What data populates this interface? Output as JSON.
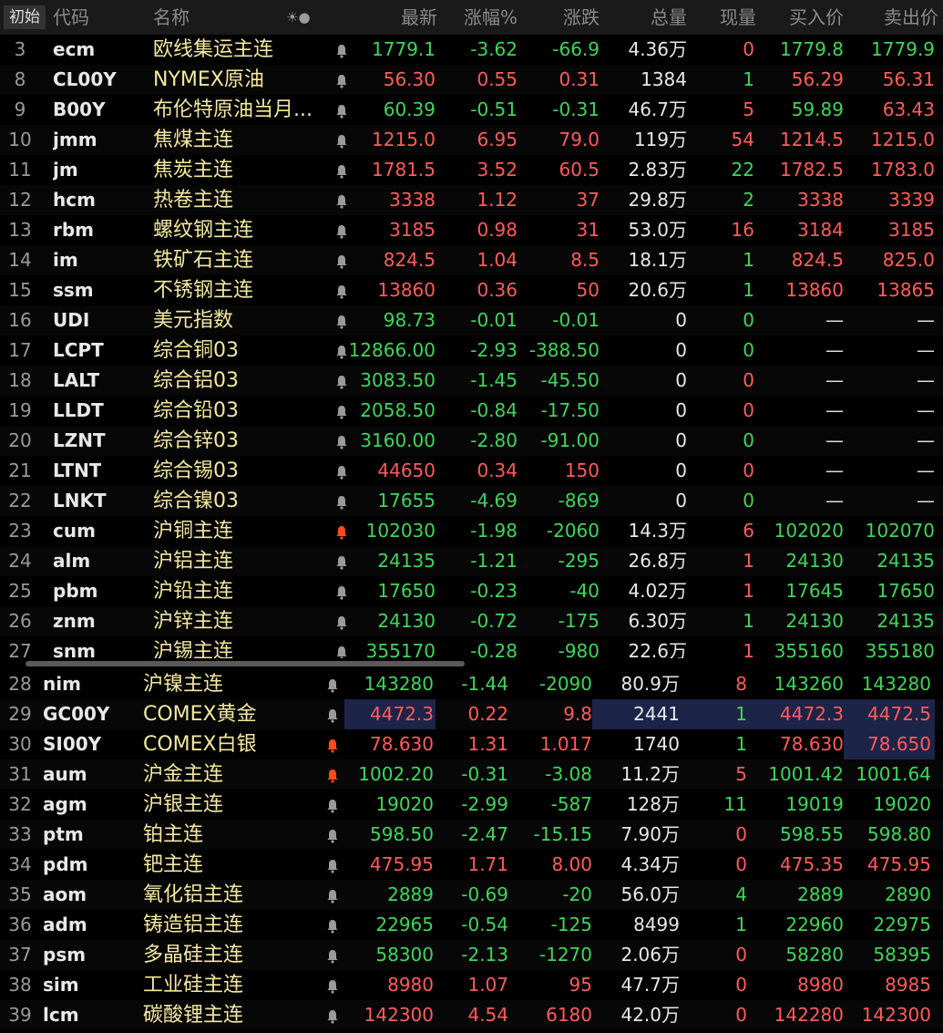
{
  "header": {
    "init_button": "初始",
    "columns": {
      "code": "代码",
      "name": "名称",
      "icons": "☀●",
      "last": "最新",
      "pct": "涨幅%",
      "chg": "涨跌",
      "vol": "总量",
      "cur": "现量",
      "bid": "买入价",
      "ask": "卖出价"
    }
  },
  "colors": {
    "up": "#ff5c5c",
    "down": "#3fd65c",
    "name": "#f4e8a0",
    "bell_active": "#ff4a1a",
    "bell_inactive": "#9a9a9a",
    "highlight": "#1c2448"
  },
  "bell_icon": "bell-icon",
  "rows": [
    {
      "no": "3",
      "code": "ecm",
      "name": "欧线集运主连",
      "bell": false,
      "last": "1779.1",
      "pct": "-3.62",
      "chg": "-66.9",
      "vol": "4.36",
      "unit": "万",
      "cur": "0",
      "bid": "1779.8",
      "ask": "1779.9",
      "lc": "dn",
      "pc": "dn",
      "bc": "dn",
      "ac": "dn",
      "cc": "zr"
    },
    {
      "no": "8",
      "code": "CL00Y",
      "name": "NYMEX原油",
      "bell": false,
      "last": "56.30",
      "pct": "0.55",
      "chg": "0.31",
      "vol": "1384",
      "unit": "",
      "cur": "1",
      "bid": "56.29",
      "ask": "56.31",
      "lc": "up",
      "pc": "up",
      "bc": "up",
      "ac": "up",
      "cc": "dn"
    },
    {
      "no": "9",
      "code": "B00Y",
      "name": "布伦特原油当月...",
      "bell": false,
      "last": "60.39",
      "pct": "-0.51",
      "chg": "-0.31",
      "vol": "46.7",
      "unit": "万",
      "cur": "5",
      "bid": "59.89",
      "ask": "63.43",
      "lc": "dn",
      "pc": "dn",
      "bc": "dn",
      "ac": "up",
      "cc": "up"
    },
    {
      "no": "10",
      "code": "jmm",
      "name": "焦煤主连",
      "bell": false,
      "last": "1215.0",
      "pct": "6.95",
      "chg": "79.0",
      "vol": "119",
      "unit": "万",
      "cur": "54",
      "bid": "1214.5",
      "ask": "1215.0",
      "lc": "up",
      "pc": "up",
      "bc": "up",
      "ac": "up",
      "cc": "up"
    },
    {
      "no": "11",
      "code": "jm",
      "name": "焦炭主连",
      "bell": false,
      "last": "1781.5",
      "pct": "3.52",
      "chg": "60.5",
      "vol": "2.83",
      "unit": "万",
      "cur": "22",
      "bid": "1782.5",
      "ask": "1783.0",
      "lc": "up",
      "pc": "up",
      "bc": "up",
      "ac": "up",
      "cc": "dn"
    },
    {
      "no": "12",
      "code": "hcm",
      "name": "热卷主连",
      "bell": false,
      "last": "3338",
      "pct": "1.12",
      "chg": "37",
      "vol": "29.8",
      "unit": "万",
      "cur": "2",
      "bid": "3338",
      "ask": "3339",
      "lc": "up",
      "pc": "up",
      "bc": "up",
      "ac": "up",
      "cc": "dn"
    },
    {
      "no": "13",
      "code": "rbm",
      "name": "螺纹钢主连",
      "bell": false,
      "last": "3185",
      "pct": "0.98",
      "chg": "31",
      "vol": "53.0",
      "unit": "万",
      "cur": "16",
      "bid": "3184",
      "ask": "3185",
      "lc": "up",
      "pc": "up",
      "bc": "up",
      "ac": "up",
      "cc": "up"
    },
    {
      "no": "14",
      "code": "im",
      "name": "铁矿石主连",
      "bell": false,
      "last": "824.5",
      "pct": "1.04",
      "chg": "8.5",
      "vol": "18.1",
      "unit": "万",
      "cur": "1",
      "bid": "824.5",
      "ask": "825.0",
      "lc": "up",
      "pc": "up",
      "bc": "up",
      "ac": "up",
      "cc": "dn"
    },
    {
      "no": "15",
      "code": "ssm",
      "name": "不锈钢主连",
      "bell": false,
      "last": "13860",
      "pct": "0.36",
      "chg": "50",
      "vol": "20.6",
      "unit": "万",
      "cur": "1",
      "bid": "13860",
      "ask": "13865",
      "lc": "up",
      "pc": "up",
      "bc": "up",
      "ac": "up",
      "cc": "dn"
    },
    {
      "no": "16",
      "code": "UDI",
      "name": "美元指数",
      "bell": false,
      "last": "98.73",
      "pct": "-0.01",
      "chg": "-0.01",
      "vol": "0",
      "unit": "",
      "cur": "0",
      "bid": "—",
      "ask": "—",
      "lc": "dn",
      "pc": "dn",
      "bc": "dash",
      "ac": "dash",
      "cc": "dn"
    },
    {
      "no": "17",
      "code": "LCPT",
      "name": "综合铜03",
      "bell": false,
      "last": "12866.00",
      "pct": "-2.93",
      "chg": "-388.50",
      "vol": "0",
      "unit": "",
      "cur": "0",
      "bid": "—",
      "ask": "—",
      "lc": "dn",
      "pc": "dn",
      "bc": "dash",
      "ac": "dash",
      "cc": "dn"
    },
    {
      "no": "18",
      "code": "LALT",
      "name": "综合铝03",
      "bell": false,
      "last": "3083.50",
      "pct": "-1.45",
      "chg": "-45.50",
      "vol": "0",
      "unit": "",
      "cur": "0",
      "bid": "—",
      "ask": "—",
      "lc": "dn",
      "pc": "dn",
      "bc": "dash",
      "ac": "dash",
      "cc": "zr"
    },
    {
      "no": "19",
      "code": "LLDT",
      "name": "综合铅03",
      "bell": false,
      "last": "2058.50",
      "pct": "-0.84",
      "chg": "-17.50",
      "vol": "0",
      "unit": "",
      "cur": "0",
      "bid": "—",
      "ask": "—",
      "lc": "dn",
      "pc": "dn",
      "bc": "dash",
      "ac": "dash",
      "cc": "zr"
    },
    {
      "no": "20",
      "code": "LZNT",
      "name": "综合锌03",
      "bell": false,
      "last": "3160.00",
      "pct": "-2.80",
      "chg": "-91.00",
      "vol": "0",
      "unit": "",
      "cur": "0",
      "bid": "—",
      "ask": "—",
      "lc": "dn",
      "pc": "dn",
      "bc": "dash",
      "ac": "dash",
      "cc": "dn"
    },
    {
      "no": "21",
      "code": "LTNT",
      "name": "综合锡03",
      "bell": false,
      "last": "44650",
      "pct": "0.34",
      "chg": "150",
      "vol": "0",
      "unit": "",
      "cur": "0",
      "bid": "—",
      "ask": "—",
      "lc": "up",
      "pc": "up",
      "bc": "dash",
      "ac": "dash",
      "cc": "zr"
    },
    {
      "no": "22",
      "code": "LNKT",
      "name": "综合镍03",
      "bell": false,
      "last": "17655",
      "pct": "-4.69",
      "chg": "-869",
      "vol": "0",
      "unit": "",
      "cur": "0",
      "bid": "—",
      "ask": "—",
      "lc": "dn",
      "pc": "dn",
      "bc": "dash",
      "ac": "dash",
      "cc": "dn"
    },
    {
      "no": "23",
      "code": "cum",
      "name": "沪铜主连",
      "bell": true,
      "last": "102030",
      "pct": "-1.98",
      "chg": "-2060",
      "vol": "14.3",
      "unit": "万",
      "cur": "6",
      "bid": "102020",
      "ask": "102070",
      "lc": "dn",
      "pc": "dn",
      "bc": "dn",
      "ac": "dn",
      "cc": "up"
    },
    {
      "no": "24",
      "code": "alm",
      "name": "沪铝主连",
      "bell": false,
      "last": "24135",
      "pct": "-1.21",
      "chg": "-295",
      "vol": "26.8",
      "unit": "万",
      "cur": "1",
      "bid": "24130",
      "ask": "24135",
      "lc": "dn",
      "pc": "dn",
      "bc": "dn",
      "ac": "dn",
      "cc": "up"
    },
    {
      "no": "25",
      "code": "pbm",
      "name": "沪铅主连",
      "bell": false,
      "last": "17650",
      "pct": "-0.23",
      "chg": "-40",
      "vol": "4.02",
      "unit": "万",
      "cur": "1",
      "bid": "17645",
      "ask": "17650",
      "lc": "dn",
      "pc": "dn",
      "bc": "dn",
      "ac": "dn",
      "cc": "up"
    },
    {
      "no": "26",
      "code": "znm",
      "name": "沪锌主连",
      "bell": false,
      "last": "24130",
      "pct": "-0.72",
      "chg": "-175",
      "vol": "6.30",
      "unit": "万",
      "cur": "1",
      "bid": "24130",
      "ask": "24135",
      "lc": "dn",
      "pc": "dn",
      "bc": "dn",
      "ac": "dn",
      "cc": "dn"
    },
    {
      "no": "27",
      "code": "snm",
      "name": "沪锡主连",
      "bell": false,
      "last": "355170",
      "pct": "-0.28",
      "chg": "-980",
      "vol": "22.6",
      "unit": "万",
      "cur": "1",
      "bid": "355160",
      "ask": "355180",
      "lc": "dn",
      "pc": "dn",
      "bc": "dn",
      "ac": "dn",
      "cc": "up"
    }
  ],
  "rows2": [
    {
      "no": "28",
      "code": "nim",
      "name": "沪镍主连",
      "bell": false,
      "last": "143280",
      "pct": "-1.44",
      "chg": "-2090",
      "vol": "80.9",
      "unit": "万",
      "cur": "8",
      "bid": "143260",
      "ask": "143280",
      "lc": "dn",
      "pc": "dn",
      "bc": "dn",
      "ac": "dn",
      "cc": "up"
    },
    {
      "no": "29",
      "code": "GC00Y",
      "name": "COMEX黄金",
      "bell": false,
      "last": "4472.3",
      "pct": "0.22",
      "chg": "9.8",
      "vol": "2441",
      "unit": "",
      "cur": "1",
      "bid": "4472.3",
      "ask": "4472.5",
      "lc": "up",
      "pc": "up",
      "bc": "up",
      "ac": "up",
      "cc": "dn",
      "hl": true
    },
    {
      "no": "30",
      "code": "SI00Y",
      "name": "COMEX白银",
      "bell": true,
      "last": "78.630",
      "pct": "1.31",
      "chg": "1.017",
      "vol": "1740",
      "unit": "",
      "cur": "1",
      "bid": "78.630",
      "ask": "78.650",
      "lc": "up",
      "pc": "up",
      "bc": "up",
      "ac": "up",
      "cc": "dn",
      "hlask": true
    },
    {
      "no": "31",
      "code": "aum",
      "name": "沪金主连",
      "bell": true,
      "last": "1002.20",
      "pct": "-0.31",
      "chg": "-3.08",
      "vol": "11.2",
      "unit": "万",
      "cur": "5",
      "bid": "1001.42",
      "ask": "1001.64",
      "lc": "dn",
      "pc": "dn",
      "bc": "dn",
      "ac": "dn",
      "cc": "up"
    },
    {
      "no": "32",
      "code": "agm",
      "name": "沪银主连",
      "bell": false,
      "last": "19020",
      "pct": "-2.99",
      "chg": "-587",
      "vol": "128",
      "unit": "万",
      "cur": "11",
      "bid": "19019",
      "ask": "19020",
      "lc": "dn",
      "pc": "dn",
      "bc": "dn",
      "ac": "dn",
      "cc": "dn"
    },
    {
      "no": "33",
      "code": "ptm",
      "name": "铂主连",
      "bell": false,
      "last": "598.50",
      "pct": "-2.47",
      "chg": "-15.15",
      "vol": "7.90",
      "unit": "万",
      "cur": "0",
      "bid": "598.55",
      "ask": "598.80",
      "lc": "dn",
      "pc": "dn",
      "bc": "dn",
      "ac": "dn",
      "cc": "zr"
    },
    {
      "no": "34",
      "code": "pdm",
      "name": "钯主连",
      "bell": false,
      "last": "475.95",
      "pct": "1.71",
      "chg": "8.00",
      "vol": "4.34",
      "unit": "万",
      "cur": "0",
      "bid": "475.35",
      "ask": "475.95",
      "lc": "up",
      "pc": "up",
      "bc": "up",
      "ac": "up",
      "cc": "zr"
    },
    {
      "no": "35",
      "code": "aom",
      "name": "氧化铝主连",
      "bell": false,
      "last": "2889",
      "pct": "-0.69",
      "chg": "-20",
      "vol": "56.0",
      "unit": "万",
      "cur": "4",
      "bid": "2889",
      "ask": "2890",
      "lc": "dn",
      "pc": "dn",
      "bc": "dn",
      "ac": "dn",
      "cc": "dn"
    },
    {
      "no": "36",
      "code": "adm",
      "name": "铸造铝主连",
      "bell": false,
      "last": "22965",
      "pct": "-0.54",
      "chg": "-125",
      "vol": "8499",
      "unit": "",
      "cur": "1",
      "bid": "22960",
      "ask": "22975",
      "lc": "dn",
      "pc": "dn",
      "bc": "dn",
      "ac": "dn",
      "cc": "dn"
    },
    {
      "no": "37",
      "code": "psm",
      "name": "多晶硅主连",
      "bell": false,
      "last": "58300",
      "pct": "-2.13",
      "chg": "-1270",
      "vol": "2.06",
      "unit": "万",
      "cur": "0",
      "bid": "58280",
      "ask": "58395",
      "lc": "dn",
      "pc": "dn",
      "bc": "dn",
      "ac": "dn",
      "cc": "zr"
    },
    {
      "no": "38",
      "code": "sim",
      "name": "工业硅主连",
      "bell": false,
      "last": "8980",
      "pct": "1.07",
      "chg": "95",
      "vol": "47.7",
      "unit": "万",
      "cur": "0",
      "bid": "8980",
      "ask": "8985",
      "lc": "up",
      "pc": "up",
      "bc": "up",
      "ac": "up",
      "cc": "zr"
    },
    {
      "no": "39",
      "code": "lcm",
      "name": "碳酸锂主连",
      "bell": false,
      "last": "142300",
      "pct": "4.54",
      "chg": "6180",
      "vol": "42.0",
      "unit": "万",
      "cur": "0",
      "bid": "142280",
      "ask": "142300",
      "lc": "up",
      "pc": "up",
      "bc": "up",
      "ac": "up",
      "cc": "zr"
    }
  ]
}
